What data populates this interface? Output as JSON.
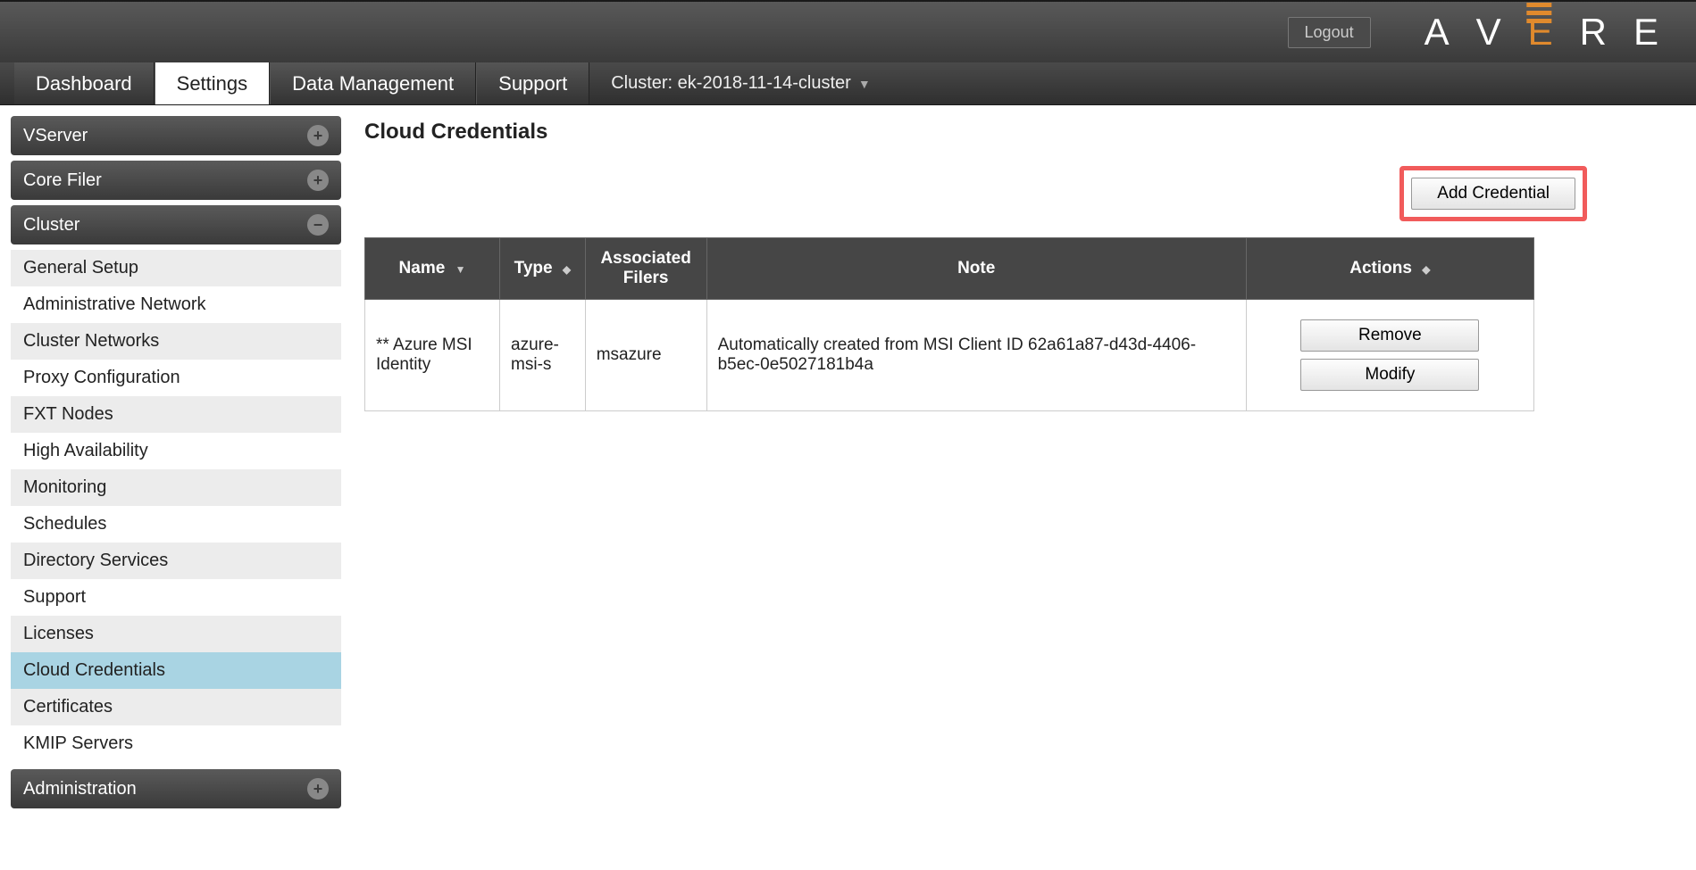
{
  "header": {
    "logout_label": "Logout",
    "logo_letters": [
      "A",
      "V",
      "E",
      "R",
      "E"
    ]
  },
  "tabs": {
    "items": [
      {
        "label": "Dashboard",
        "active": false
      },
      {
        "label": "Settings",
        "active": true
      },
      {
        "label": "Data Management",
        "active": false
      },
      {
        "label": "Support",
        "active": false
      }
    ],
    "cluster_prefix": "Cluster:",
    "cluster_name": "ek-2018-11-14-cluster"
  },
  "sidebar": {
    "sections": [
      {
        "label": "VServer",
        "expanded": false,
        "items": []
      },
      {
        "label": "Core Filer",
        "expanded": false,
        "items": []
      },
      {
        "label": "Cluster",
        "expanded": true,
        "items": [
          {
            "label": "General Setup"
          },
          {
            "label": "Administrative Network"
          },
          {
            "label": "Cluster Networks"
          },
          {
            "label": "Proxy Configuration"
          },
          {
            "label": "FXT Nodes"
          },
          {
            "label": "High Availability"
          },
          {
            "label": "Monitoring"
          },
          {
            "label": "Schedules"
          },
          {
            "label": "Directory Services"
          },
          {
            "label": "Support"
          },
          {
            "label": "Licenses"
          },
          {
            "label": "Cloud Credentials",
            "active": true
          },
          {
            "label": "Certificates"
          },
          {
            "label": "KMIP Servers"
          }
        ]
      },
      {
        "label": "Administration",
        "expanded": false,
        "items": []
      }
    ]
  },
  "page": {
    "title": "Cloud Credentials",
    "add_button_label": "Add Credential",
    "columns": {
      "name": "Name",
      "type": "Type",
      "assoc": "Associated Filers",
      "note": "Note",
      "actions": "Actions"
    },
    "rows": [
      {
        "name": "** Azure MSI Identity",
        "type": "azure-msi-s",
        "assoc": "msazure",
        "note": "Automatically created from MSI Client ID 62a61a87-d43d-4406-b5ec-0e5027181b4a",
        "remove_label": "Remove",
        "modify_label": "Modify"
      }
    ]
  }
}
